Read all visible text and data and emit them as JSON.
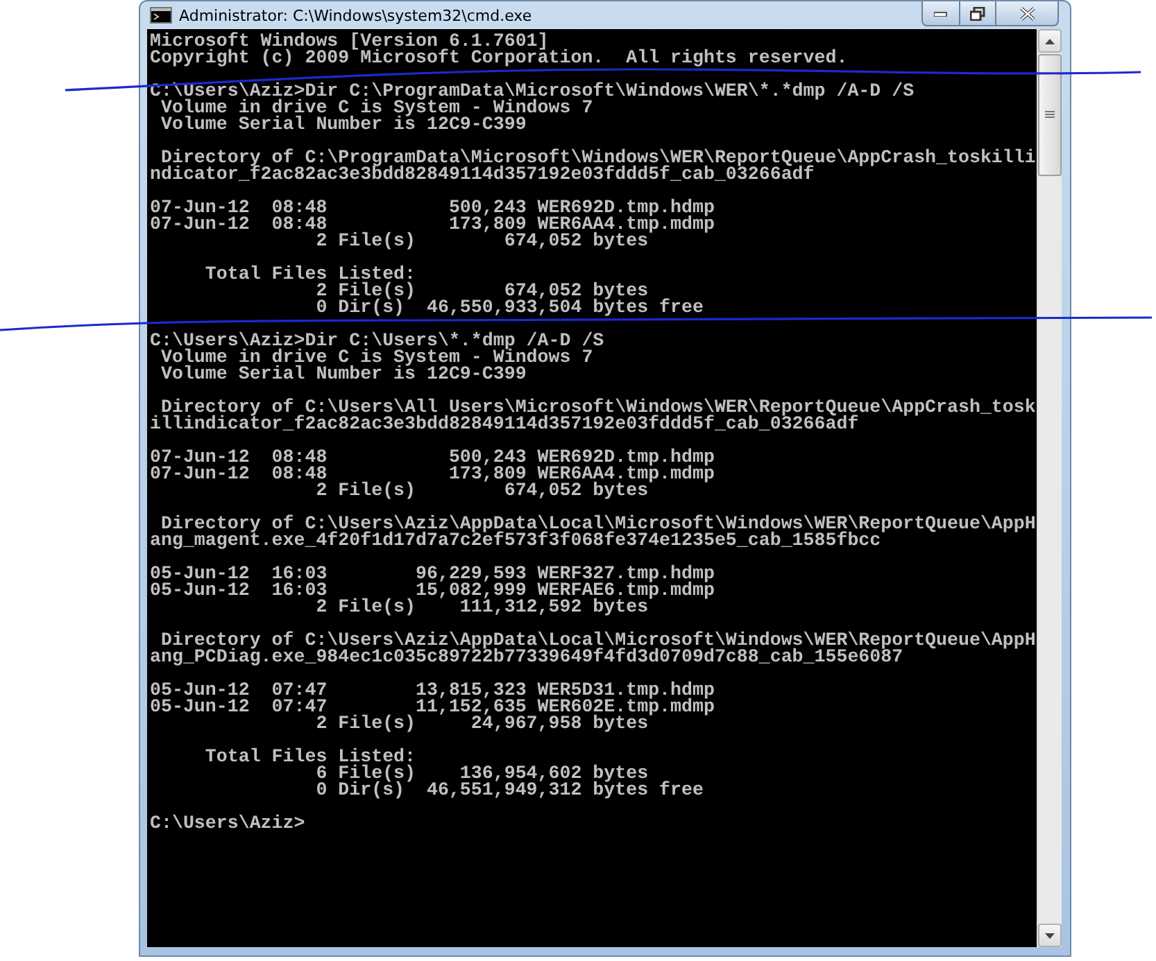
{
  "window": {
    "title": "Administrator: C:\\Windows\\system32\\cmd.exe"
  },
  "console": {
    "blocks": [
      {
        "lines": [
          "Microsoft Windows [Version 6.1.7601]",
          "Copyright (c) 2009 Microsoft Corporation.  All rights reserved."
        ]
      },
      {
        "lines": [
          "C:\\Users\\Aziz>Dir C:\\ProgramData\\Microsoft\\Windows\\WER\\*.*dmp /A-D /S",
          " Volume in drive C is System - Windows 7",
          " Volume Serial Number is 12C9-C399"
        ]
      },
      {
        "lines": [
          " Directory of C:\\ProgramData\\Microsoft\\Windows\\WER\\ReportQueue\\AppCrash_toskilli",
          "ndicator_f2ac82ac3e3bdd82849114d357192e03fddd5f_cab_03266adf"
        ]
      },
      {
        "lines": [
          "07-Jun-12  08:48           500,243 WER692D.tmp.hdmp",
          "07-Jun-12  08:48           173,809 WER6AA4.tmp.mdmp",
          "               2 File(s)        674,052 bytes"
        ]
      },
      {
        "lines": [
          "     Total Files Listed:",
          "               2 File(s)        674,052 bytes",
          "               0 Dir(s)  46,550,933,504 bytes free"
        ]
      },
      {
        "lines": [
          "C:\\Users\\Aziz>Dir C:\\Users\\*.*dmp /A-D /S",
          " Volume in drive C is System - Windows 7",
          " Volume Serial Number is 12C9-C399"
        ]
      },
      {
        "lines": [
          " Directory of C:\\Users\\All Users\\Microsoft\\Windows\\WER\\ReportQueue\\AppCrash_tosk",
          "illindicator_f2ac82ac3e3bdd82849114d357192e03fddd5f_cab_03266adf"
        ]
      },
      {
        "lines": [
          "07-Jun-12  08:48           500,243 WER692D.tmp.hdmp",
          "07-Jun-12  08:48           173,809 WER6AA4.tmp.mdmp",
          "               2 File(s)        674,052 bytes"
        ]
      },
      {
        "lines": [
          " Directory of C:\\Users\\Aziz\\AppData\\Local\\Microsoft\\Windows\\WER\\ReportQueue\\AppH",
          "ang_magent.exe_4f20f1d17d7a7c2ef573f3f068fe374e1235e5_cab_1585fbcc"
        ]
      },
      {
        "lines": [
          "05-Jun-12  16:03        96,229,593 WERF327.tmp.hdmp",
          "05-Jun-12  16:03        15,082,999 WERFAE6.tmp.mdmp",
          "               2 File(s)    111,312,592 bytes"
        ]
      },
      {
        "lines": [
          " Directory of C:\\Users\\Aziz\\AppData\\Local\\Microsoft\\Windows\\WER\\ReportQueue\\AppH",
          "ang_PCDiag.exe_984ec1c035c89722b77339649f4fd3d0709d7c88_cab_155e6087"
        ]
      },
      {
        "lines": [
          "05-Jun-12  07:47        13,815,323 WER5D31.tmp.hdmp",
          "05-Jun-12  07:47        11,152,635 WER602E.tmp.mdmp",
          "               2 File(s)     24,967,958 bytes"
        ]
      },
      {
        "lines": [
          "     Total Files Listed:",
          "               6 File(s)    136,954,602 bytes",
          "               0 Dir(s)  46,551,949,312 bytes free"
        ]
      },
      {
        "lines": [
          "C:\\Users\\Aziz>"
        ]
      }
    ]
  }
}
